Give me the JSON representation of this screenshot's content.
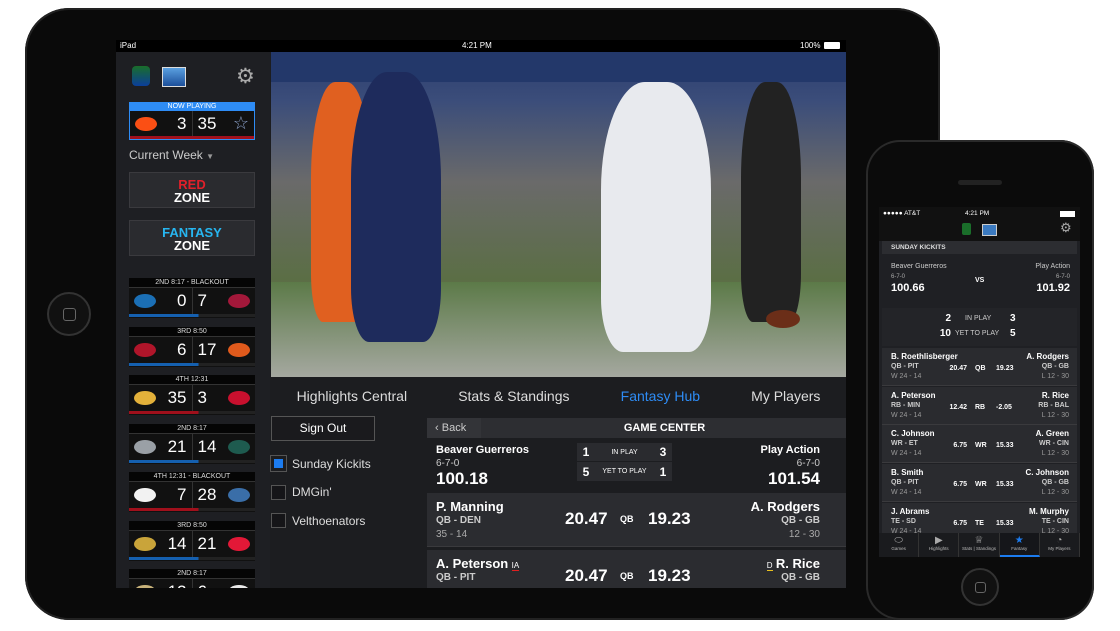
{
  "ipad": {
    "status": {
      "device": "iPad",
      "time": "4:21 PM",
      "battery": "100%"
    },
    "now_playing": {
      "label": "NOW PLAYING",
      "home_logo": "broncos-logo",
      "home_score": "3",
      "away_score": "35",
      "away_logo": "cowboys-star-logo"
    },
    "week_selector": "Current Week",
    "red_zone": {
      "line1": "RED",
      "line2": "ZONE"
    },
    "fantasy_zone": {
      "line1": "FANTASY",
      "line2": "ZONE"
    },
    "games": [
      {
        "status": "2ND  8:17 - BLACKOUT",
        "home_logo": "lions-logo",
        "home_score": "0",
        "away_score": "7",
        "away_logo": "cardinals-logo",
        "home_color": "#1b6fb5",
        "away_color": "#a3183a",
        "bar": "#1560b0"
      },
      {
        "status": "3RD  8:50",
        "home_logo": "falcons-logo",
        "home_score": "6",
        "away_score": "17",
        "away_logo": "bears-logo",
        "home_color": "#b0152a",
        "away_color": "#e05a1c",
        "bar": "#1560b0"
      },
      {
        "status": "4TH  12:31",
        "home_logo": "vikings-logo",
        "home_score": "35",
        "away_score": "3",
        "away_logo": "giants-logo",
        "home_color": "#e3b13a",
        "away_color": "#c8102e",
        "bar": "#a0101c"
      },
      {
        "status": "2ND  8:17",
        "home_logo": "raiders-logo",
        "home_score": "21",
        "away_score": "14",
        "away_logo": "eagles-logo",
        "home_color": "#9aa0a6",
        "away_color": "#1e5b4f",
        "bar": "#1560b0"
      },
      {
        "status": "4TH  12:31 - BLACKOUT",
        "home_logo": "steelers-logo",
        "home_score": "7",
        "away_score": "28",
        "away_logo": "seahawks-logo",
        "home_color": "#f2f2f2",
        "away_color": "#3a6ea8",
        "bar": "#a0101c"
      },
      {
        "status": "3RD  8:50",
        "home_logo": "jaguars-logo",
        "home_score": "14",
        "away_score": "21",
        "away_logo": "chiefs-logo",
        "home_color": "#c9a43a",
        "away_color": "#e31837",
        "bar": "#1560b0"
      },
      {
        "status": "2ND  8:17",
        "home_logo": "saints-logo",
        "home_score": "12",
        "away_score": "6",
        "away_logo": "jets-logo",
        "home_color": "#c8b27a",
        "away_color": "#eaeaea",
        "bar": "#1560b0"
      }
    ],
    "tabs": [
      "Highlights Central",
      "Stats & Standings",
      "Fantasy Hub",
      "My Players"
    ],
    "active_tab": "Fantasy Hub",
    "sign_out": "Sign Out",
    "leagues": [
      {
        "label": "Sunday Kickits",
        "checked": true
      },
      {
        "label": "DMGin'",
        "checked": false
      },
      {
        "label": "Velthoenators",
        "checked": false
      }
    ],
    "game_center": {
      "back": "Back",
      "title": "GAME CENTER",
      "home": {
        "name": "Beaver Guerreros",
        "record": "6-7-0",
        "score": "100.18"
      },
      "away": {
        "name": "Play Action",
        "record": "6-7-0",
        "score": "101.54"
      },
      "in_play": {
        "label": "IN PLAY",
        "home": "1",
        "away": "3"
      },
      "yet_to_play": {
        "label": "YET TO PLAY",
        "home": "5",
        "away": "1"
      },
      "matchups": [
        {
          "home_name": "P. Manning",
          "home_pos": "QB - DEN",
          "home_rec": "35 - 14",
          "home_pts": "20.47",
          "pos": "QB",
          "away_pts": "19.23",
          "away_name": "A. Rodgers",
          "away_pos": "QB - GB",
          "away_rec": "12 - 30"
        },
        {
          "home_name": "A. Peterson",
          "home_tag": "IA",
          "home_pos": "QB - PIT",
          "home_pts": "20.47",
          "pos": "QB",
          "away_pts": "19.23",
          "away_tag": "D",
          "away_name": "R. Rice",
          "away_pos": "QB - GB"
        }
      ]
    }
  },
  "iphone": {
    "status": {
      "carrier": "●●●●● AT&T",
      "time": "4:21 PM"
    },
    "league": "SUNDAY KICKITS",
    "home": {
      "name": "Beaver Guerreros",
      "record": "6-7-0",
      "score": "100.66"
    },
    "vs": "VS",
    "away": {
      "name": "Play Action",
      "record": "6-7-0",
      "score": "101.92"
    },
    "in_play": {
      "label": "IN PLAY",
      "home": "2",
      "away": "3"
    },
    "yet_to_play": {
      "label": "YET TO PLAY",
      "home": "10",
      "away": "5"
    },
    "matchups": [
      {
        "hn": "B. Roethlisberger",
        "hp": "QB - PIT",
        "hr": "W 24 - 14",
        "hs": "20.47",
        "pos": "QB",
        "as": "19.23",
        "an": "A. Rodgers",
        "ap": "QB - GB",
        "ar": "L 12 - 30"
      },
      {
        "hn": "A. Peterson",
        "hp": "RB - MIN",
        "hr": "W 24 - 14",
        "hs": "12.42",
        "pos": "RB",
        "as": "-2.05",
        "an": "R. Rice",
        "ap": "RB - BAL",
        "ar": "L 12 - 30"
      },
      {
        "hn": "C. Johnson",
        "hp": "WR - ET",
        "hr": "W 24 - 14",
        "hs": "6.75",
        "pos": "WR",
        "as": "15.33",
        "an": "A. Green",
        "ap": "WR - CIN",
        "ar": "L 12 - 30"
      },
      {
        "hn": "B. Smith",
        "hp": "QB - PIT",
        "hr": "W 24 - 14",
        "hs": "6.75",
        "pos": "WR",
        "as": "15.33",
        "an": "C. Johnson",
        "ap": "QB - GB",
        "ar": "L 12 - 30"
      },
      {
        "hn": "J. Abrams",
        "hp": "TE - SD",
        "hr": "W 24 - 14",
        "hs": "6.75",
        "pos": "TE",
        "as": "15.33",
        "an": "M. Murphy",
        "ap": "TE - CIN",
        "ar": "L 12 - 30"
      }
    ],
    "nav": [
      {
        "label": "Games",
        "icon": "football-icon"
      },
      {
        "label": "Highlights",
        "icon": "play-icon"
      },
      {
        "label": "Stats | Standings",
        "icon": "trophy-icon"
      },
      {
        "label": "Fantasy",
        "icon": "star-icon",
        "active": true
      },
      {
        "label": "My Players",
        "icon": "helmet-icon"
      }
    ]
  },
  "colors": {
    "accent": "#2e8cf5",
    "red_zone": "#e0202a",
    "fantasy_zone": "#27b6f0"
  }
}
